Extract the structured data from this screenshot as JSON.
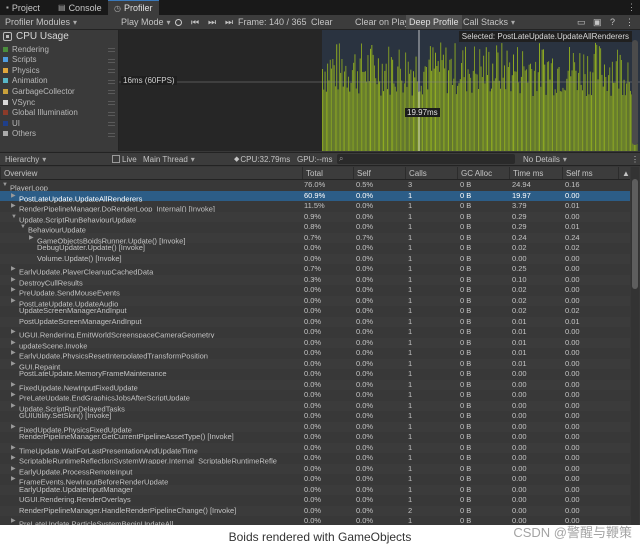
{
  "tabs": [
    {
      "label": "Project",
      "icon": "folder-icon"
    },
    {
      "label": "Console",
      "icon": "console-icon"
    },
    {
      "label": "Profiler",
      "icon": "profiler-icon",
      "active": true
    }
  ],
  "toolbar": {
    "modules": "Profiler Modules",
    "play_mode": "Play Mode",
    "frame": "Frame: 140 / 365",
    "clear": "Clear",
    "clear_on_play": "Clear on Play",
    "deep_profile": "Deep Profile",
    "call_stacks": "Call Stacks"
  },
  "cpu_module": {
    "title": "CPU Usage",
    "legend": [
      {
        "label": "Rendering",
        "color": "#4b8d3d"
      },
      {
        "label": "Scripts",
        "color": "#4f9ce0"
      },
      {
        "label": "Physics",
        "color": "#e0a63b"
      },
      {
        "label": "Animation",
        "color": "#58b7c7"
      },
      {
        "label": "GarbageCollector",
        "color": "#c9a13b"
      },
      {
        "label": "VSync",
        "color": "#d8d8d8"
      },
      {
        "label": "Global Illumination",
        "color": "#8c3b2a"
      },
      {
        "label": "UI",
        "color": "#1f3f8a"
      },
      {
        "label": "Others",
        "color": "#aaaaaa"
      }
    ]
  },
  "chart": {
    "selected_label": "Selected: PostLateUpdate.UpdateAllRenderers",
    "fps_label": "16ms (60FPS)",
    "value_label": "19.97ms",
    "bar_color": "#9ab91e"
  },
  "hierarchy": {
    "view": "Hierarchy",
    "thread": "Main Thread",
    "cpu": "CPU:32.79ms",
    "gpu": "GPU:--ms",
    "details": "No Details",
    "live": "Live"
  },
  "columns": [
    "Overview",
    "Total",
    "Self",
    "Calls",
    "GC Alloc",
    "Time ms",
    "Self ms"
  ],
  "rows": [
    {
      "indent": 0,
      "fold": "open",
      "name": "PlayerLoop",
      "total": "76.0%",
      "self": "0.5%",
      "calls": "3",
      "gc": "0 B",
      "time": "24.94",
      "selfms": "0.16"
    },
    {
      "indent": 1,
      "fold": "closed",
      "name": "PostLateUpdate.UpdateAllRenderers",
      "total": "60.9%",
      "self": "0.0%",
      "calls": "1",
      "gc": "0 B",
      "time": "19.97",
      "selfms": "0.00",
      "selected": true
    },
    {
      "indent": 1,
      "fold": "closed",
      "name": "RenderPipelineManager.DoRenderLoop_Internal() [Invoke]",
      "total": "11.5%",
      "self": "0.0%",
      "calls": "1",
      "gc": "0 B",
      "time": "3.79",
      "selfms": "0.01"
    },
    {
      "indent": 1,
      "fold": "open",
      "name": "Update.ScriptRunBehaviourUpdate",
      "total": "0.9%",
      "self": "0.0%",
      "calls": "1",
      "gc": "0 B",
      "time": "0.29",
      "selfms": "0.00"
    },
    {
      "indent": 2,
      "fold": "open",
      "name": "BehaviourUpdate",
      "total": "0.8%",
      "self": "0.0%",
      "calls": "1",
      "gc": "0 B",
      "time": "0.29",
      "selfms": "0.01"
    },
    {
      "indent": 3,
      "fold": "closed",
      "name": "GameObjectsBoidsRunner.Update() [Invoke]",
      "total": "0.7%",
      "self": "0.7%",
      "calls": "1",
      "gc": "0 B",
      "time": "0.24",
      "selfms": "0.24"
    },
    {
      "indent": 3,
      "fold": "",
      "name": "DebugUpdater.Update() [Invoke]",
      "total": "0.0%",
      "self": "0.0%",
      "calls": "1",
      "gc": "0 B",
      "time": "0.02",
      "selfms": "0.02"
    },
    {
      "indent": 3,
      "fold": "",
      "name": "Volume.Update() [Invoke]",
      "total": "0.0%",
      "self": "0.0%",
      "calls": "1",
      "gc": "0 B",
      "time": "0.00",
      "selfms": "0.00"
    },
    {
      "indent": 1,
      "fold": "closed",
      "name": "EarlyUpdate.PlayerCleanupCachedData",
      "total": "0.7%",
      "self": "0.0%",
      "calls": "1",
      "gc": "0 B",
      "time": "0.25",
      "selfms": "0.00"
    },
    {
      "indent": 1,
      "fold": "closed",
      "name": "DestroyCullResults",
      "total": "0.3%",
      "self": "0.0%",
      "calls": "1",
      "gc": "0 B",
      "time": "0.10",
      "selfms": "0.00"
    },
    {
      "indent": 1,
      "fold": "closed",
      "name": "PreUpdate.SendMouseEvents",
      "total": "0.0%",
      "self": "0.0%",
      "calls": "1",
      "gc": "0 B",
      "time": "0.02",
      "selfms": "0.00"
    },
    {
      "indent": 1,
      "fold": "closed",
      "name": "PostLateUpdate.UpdateAudio",
      "total": "0.0%",
      "self": "0.0%",
      "calls": "1",
      "gc": "0 B",
      "time": "0.02",
      "selfms": "0.00"
    },
    {
      "indent": 1,
      "fold": "",
      "name": "UpdateScreenManagerAndInput",
      "total": "0.0%",
      "self": "0.0%",
      "calls": "1",
      "gc": "0 B",
      "time": "0.02",
      "selfms": "0.02"
    },
    {
      "indent": 1,
      "fold": "",
      "name": "PostUpdateScreenManagerAndInput",
      "total": "0.0%",
      "self": "0.0%",
      "calls": "1",
      "gc": "0 B",
      "time": "0.01",
      "selfms": "0.01"
    },
    {
      "indent": 1,
      "fold": "closed",
      "name": "UGUI.Rendering.EmitWorldScreenspaceCameraGeometry",
      "total": "0.0%",
      "self": "0.0%",
      "calls": "1",
      "gc": "0 B",
      "time": "0.01",
      "selfms": "0.00"
    },
    {
      "indent": 1,
      "fold": "closed",
      "name": "updateScene.Invoke",
      "total": "0.0%",
      "self": "0.0%",
      "calls": "1",
      "gc": "0 B",
      "time": "0.01",
      "selfms": "0.00"
    },
    {
      "indent": 1,
      "fold": "closed",
      "name": "EarlyUpdate.PhysicsResetInterpolatedTransformPosition",
      "total": "0.0%",
      "self": "0.0%",
      "calls": "1",
      "gc": "0 B",
      "time": "0.01",
      "selfms": "0.00"
    },
    {
      "indent": 1,
      "fold": "closed",
      "name": "GUI.Repaint",
      "total": "0.0%",
      "self": "0.0%",
      "calls": "1",
      "gc": "0 B",
      "time": "0.01",
      "selfms": "0.00"
    },
    {
      "indent": 1,
      "fold": "",
      "name": "PostLateUpdate.MemoryFrameMaintenance",
      "total": "0.0%",
      "self": "0.0%",
      "calls": "1",
      "gc": "0 B",
      "time": "0.00",
      "selfms": "0.00"
    },
    {
      "indent": 1,
      "fold": "closed",
      "name": "FixedUpdate.NewInputFixedUpdate",
      "total": "0.0%",
      "self": "0.0%",
      "calls": "1",
      "gc": "0 B",
      "time": "0.00",
      "selfms": "0.00"
    },
    {
      "indent": 1,
      "fold": "closed",
      "name": "PreLateUpdate.EndGraphicsJobsAfterScriptUpdate",
      "total": "0.0%",
      "self": "0.0%",
      "calls": "1",
      "gc": "0 B",
      "time": "0.00",
      "selfms": "0.00"
    },
    {
      "indent": 1,
      "fold": "closed",
      "name": "Update.ScriptRunDelayedTasks",
      "total": "0.0%",
      "self": "0.0%",
      "calls": "1",
      "gc": "0 B",
      "time": "0.00",
      "selfms": "0.00"
    },
    {
      "indent": 1,
      "fold": "",
      "name": "GUIUtility.SetSkin() [Invoke]",
      "total": "0.0%",
      "self": "0.0%",
      "calls": "1",
      "gc": "0 B",
      "time": "0.00",
      "selfms": "0.00"
    },
    {
      "indent": 1,
      "fold": "closed",
      "name": "FixedUpdate.PhysicsFixedUpdate",
      "total": "0.0%",
      "self": "0.0%",
      "calls": "1",
      "gc": "0 B",
      "time": "0.00",
      "selfms": "0.00"
    },
    {
      "indent": 1,
      "fold": "",
      "name": "RenderPipelineManager.GetCurrentPipelineAssetType() [Invoke]",
      "total": "0.0%",
      "self": "0.0%",
      "calls": "1",
      "gc": "0 B",
      "time": "0.00",
      "selfms": "0.00"
    },
    {
      "indent": 1,
      "fold": "closed",
      "name": "TimeUpdate.WaitForLastPresentationAndUpdateTime",
      "total": "0.0%",
      "self": "0.0%",
      "calls": "1",
      "gc": "0 B",
      "time": "0.00",
      "selfms": "0.00"
    },
    {
      "indent": 1,
      "fold": "closed",
      "name": "ScriptableRuntimeReflectionSystemWrapper.Internal_ScriptableRuntimeRefle",
      "total": "0.0%",
      "self": "0.0%",
      "calls": "1",
      "gc": "0 B",
      "time": "0.00",
      "selfms": "0.00"
    },
    {
      "indent": 1,
      "fold": "closed",
      "name": "EarlyUpdate.ProcessRemoteInput",
      "total": "0.0%",
      "self": "0.0%",
      "calls": "1",
      "gc": "0 B",
      "time": "0.00",
      "selfms": "0.00"
    },
    {
      "indent": 1,
      "fold": "closed",
      "name": "FrameEvents.NewInputBeforeRenderUpdate",
      "total": "0.0%",
      "self": "0.0%",
      "calls": "1",
      "gc": "0 B",
      "time": "0.00",
      "selfms": "0.00"
    },
    {
      "indent": 1,
      "fold": "",
      "name": "EarlyUpdate.UpdateInputManager",
      "total": "0.0%",
      "self": "0.0%",
      "calls": "1",
      "gc": "0 B",
      "time": "0.00",
      "selfms": "0.00"
    },
    {
      "indent": 1,
      "fold": "",
      "name": "UGUI.Rendering.RenderOverlays",
      "total": "0.0%",
      "self": "0.0%",
      "calls": "1",
      "gc": "0 B",
      "time": "0.00",
      "selfms": "0.00"
    },
    {
      "indent": 1,
      "fold": "",
      "name": "RenderPipelineManager.HandleRenderPipelineChange() [Invoke]",
      "total": "0.0%",
      "self": "0.0%",
      "calls": "2",
      "gc": "0 B",
      "time": "0.00",
      "selfms": "0.00"
    },
    {
      "indent": 1,
      "fold": "closed",
      "name": "PreLateUpdate.ParticleSystemBeginUpdateAll",
      "total": "0.0%",
      "self": "0.0%",
      "calls": "1",
      "gc": "0 B",
      "time": "0.00",
      "selfms": "0.00"
    }
  ],
  "caption": "Boids rendered with GameObjects",
  "watermark": "CSDN @警醒与鞭策"
}
